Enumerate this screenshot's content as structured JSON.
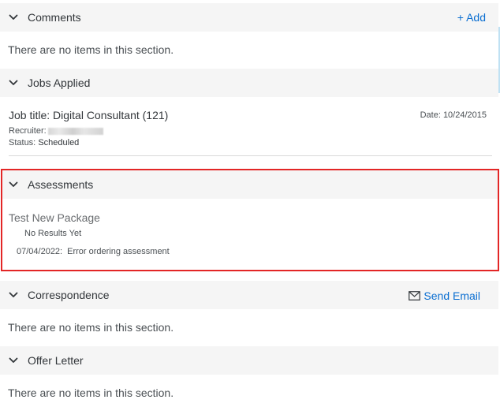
{
  "sections": {
    "comments": {
      "title": "Comments",
      "action_label": "+ Add",
      "empty_text": "There are no items in this section."
    },
    "jobs_applied": {
      "title": "Jobs Applied",
      "job": {
        "title": "Job title: Digital Consultant (121)",
        "date": "Date: 10/24/2015",
        "recruiter_label": "Recruiter:",
        "status_label": "Status:",
        "status_value": "Scheduled"
      }
    },
    "assessments": {
      "title": "Assessments",
      "package_name": "Test New Package",
      "results": "No Results Yet",
      "status_date": "07/04/2022:",
      "status_text": "Error ordering assessment"
    },
    "correspondence": {
      "title": "Correspondence",
      "action_label": "Send Email",
      "action_icon": "mail-icon",
      "empty_text": "There are no items in this section."
    },
    "offer_letter": {
      "title": "Offer Letter",
      "empty_text": "There are no items in this section."
    }
  },
  "colors": {
    "header_bg": "#f5f5f5",
    "link": "#0a6ed1",
    "highlight_border": "#e32626"
  },
  "icons": {
    "section_toggle": "chevron-down-icon"
  }
}
